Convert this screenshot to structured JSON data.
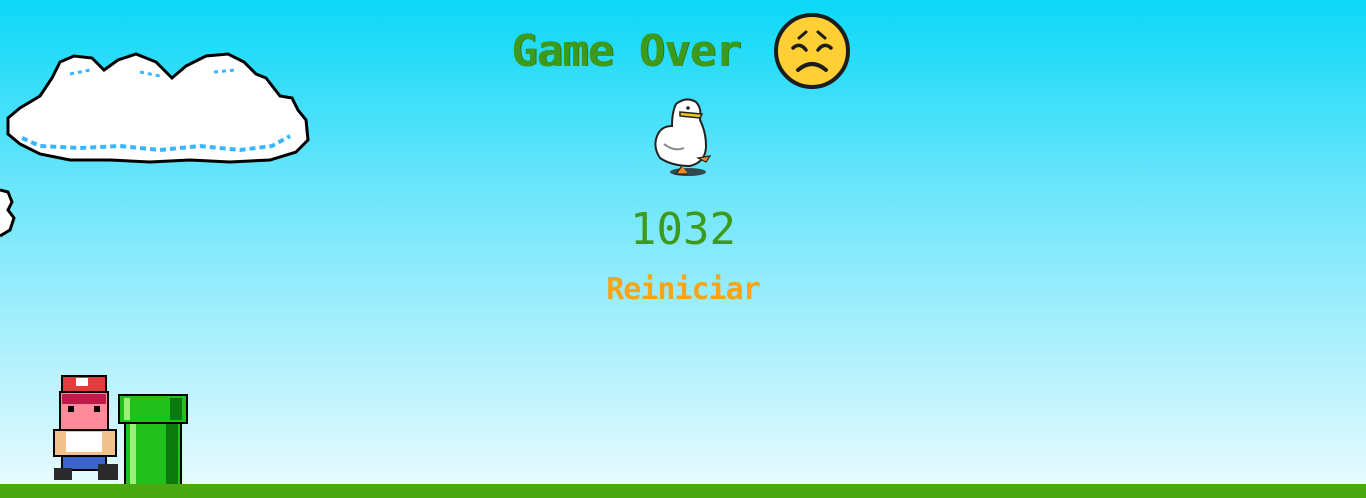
{
  "game": {
    "title": "Game Over",
    "score": "1032",
    "restart_label": "Reiniciar"
  },
  "colors": {
    "sky_top": "#0bd8f8",
    "sky_bottom": "#e6fbff",
    "ground": "#4aa810",
    "title_green": "#3d9a1a",
    "restart_orange": "#f7a416"
  },
  "icons": {
    "face": "disappointed-face-emoji",
    "duck": "white-duck-sprite",
    "player": "mario-sprite",
    "pipe": "green-warp-pipe",
    "cloud": "pixel-cloud"
  }
}
